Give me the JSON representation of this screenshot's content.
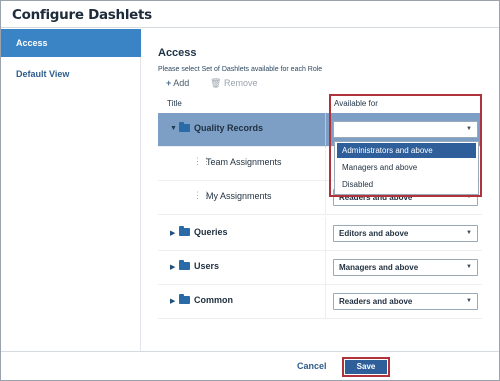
{
  "window": {
    "title": "Configure Dashlets"
  },
  "sidebar": {
    "items": [
      {
        "label": "Access",
        "active": true
      },
      {
        "label": "Default View",
        "active": false
      }
    ]
  },
  "main": {
    "section_title": "Access",
    "description": "Please select Set of Dashlets available for each Role",
    "toolbar": {
      "add_label": "Add",
      "remove_label": "Remove"
    },
    "columns": {
      "title": "Title",
      "available_for": "Available for"
    },
    "rows": [
      {
        "label": "Quality Records",
        "type": "folder",
        "expanded": true,
        "selected": true,
        "value": ""
      },
      {
        "label": "Team Assignments",
        "type": "item",
        "value": ""
      },
      {
        "label": "My Assignments",
        "type": "item",
        "value": "Readers and above"
      },
      {
        "label": "Queries",
        "type": "folder",
        "expanded": false,
        "value": "Editors and above"
      },
      {
        "label": "Users",
        "type": "folder",
        "expanded": false,
        "value": "Managers and above"
      },
      {
        "label": "Common",
        "type": "folder",
        "expanded": false,
        "value": "Readers and above"
      }
    ],
    "dropdown": {
      "options": [
        {
          "label": "Administrators and above",
          "highlighted": true
        },
        {
          "label": "Managers and above",
          "highlighted": false
        },
        {
          "label": "Disabled",
          "highlighted": false
        }
      ]
    }
  },
  "footer": {
    "cancel_label": "Cancel",
    "save_label": "Save"
  },
  "colors": {
    "accent": "#3a83c5",
    "selected_row": "#7d9fc6",
    "highlight_border": "#b0323a",
    "button": "#2f5f9a"
  }
}
